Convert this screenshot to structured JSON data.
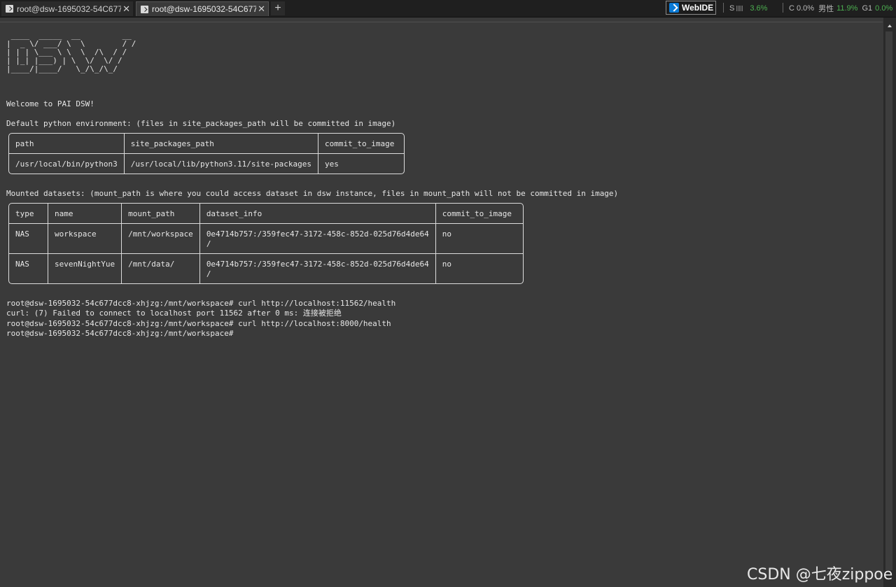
{
  "tabs": [
    {
      "label": "root@dsw-1695032-54C677I",
      "close": "✕"
    },
    {
      "label": "root@dsw-1695032-54C677I",
      "close": "✕"
    }
  ],
  "new_tab": "+",
  "webide": {
    "label": "WebIDE"
  },
  "stats": {
    "s_label": "S",
    "s_value": "3.6%",
    "c_label": "C 0.0%",
    "mem_label": "男性",
    "mem_value": "11.9%",
    "g_label": "G1",
    "g_value": "0.0%"
  },
  "terminal": {
    "logo": " ____  _____  __         __\n|  _ \\/ ___/ \\  \\        / /\n| | | \\___ \\ \\  \\  /\\  / /\n| |_| |___) | \\  \\/  \\/ /\n|____/|____/   \\_/\\_/\\_/",
    "welcome": "Welcome to PAI DSW!",
    "env_heading": "Default python environment: (files in site_packages_path will be committed in image)",
    "env_table": {
      "headers": [
        "path",
        "site_packages_path",
        "commit_to_image"
      ],
      "rows": [
        [
          "/usr/local/bin/python3",
          "/usr/local/lib/python3.11/site-packages",
          "yes"
        ]
      ]
    },
    "datasets_heading": "Mounted datasets: (mount_path is where you could access dataset in dsw instance, files in mount_path will not be committed in image)",
    "datasets_table": {
      "headers": [
        "type",
        "name",
        "mount_path",
        "dataset_info",
        "commit_to_image"
      ],
      "rows": [
        [
          "NAS",
          "workspace",
          "/mnt/workspace",
          "0e4714b757:/359fec47-3172-458c-852d-025d76d4de64\n/",
          "no"
        ],
        [
          "NAS",
          "sevenNightYue",
          "/mnt/data/",
          "0e4714b757:/359fec47-3172-458c-852d-025d76d4de64\n/",
          "no"
        ]
      ]
    },
    "lines": [
      "root@dsw-1695032-54c677dcc8-xhjzg:/mnt/workspace# curl http://localhost:11562/health",
      "curl: (7) Failed to connect to localhost port 11562 after 0 ms: 连接被拒绝",
      "root@dsw-1695032-54c677dcc8-xhjzg:/mnt/workspace# curl http://localhost:8000/health",
      "root@dsw-1695032-54c677dcc8-xhjzg:/mnt/workspace#"
    ]
  },
  "watermark": "CSDN @七夜zippoe"
}
